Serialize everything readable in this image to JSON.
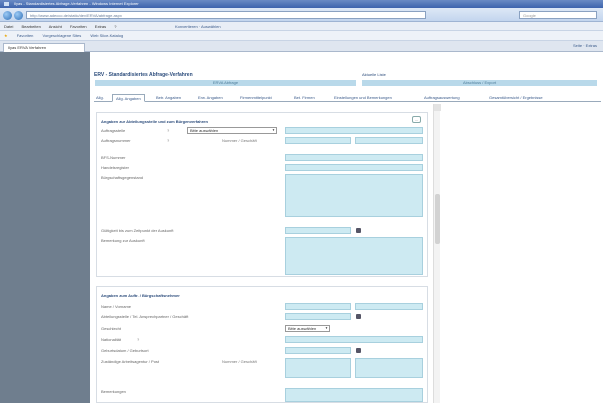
{
  "window": {
    "title": "Ilyas - Standardisiertes Abfrage-Verfahren - Windows Internet Explorer"
  },
  "browser": {
    "url": "http://www.adecco.de/static/dev/ERVA/abfrage.aspx",
    "search_placeholder": "Google",
    "menu": [
      "Datei",
      "Bearbeiten",
      "Ansicht",
      "Favoriten",
      "Extras",
      "?"
    ],
    "menu_right": "Konvertieren · Auswählen",
    "favorites": [
      "Favoriten",
      "Vorgeschlagene Sites",
      "Web Slice-Katalog"
    ],
    "tab_label": "Ilyas ERVA Verfahren",
    "tools": "Seite · Extras"
  },
  "page": {
    "title": "ERV - Standardisiertes Abfrage-Verfahren",
    "subtitle": "Aktuelle Liste",
    "bar_left": "ERVA Abfrage",
    "bar_right": "Abschluss / Export",
    "tabs": [
      "Allg.",
      "Allg. Angaben",
      "Betr. Angaben",
      "Erw. Angaben",
      "Firmenmittelpunkt",
      "Bet. Firmen",
      "Einstellungen und Bemerkungen",
      "Auftragsauswertung",
      "Gesamtübersicht / Ergebnisse"
    ]
  },
  "section1": {
    "heading": "Angaben zur Abteilungsstelle und zum Bürgenverfahren",
    "rows": [
      {
        "label": "Auftragsstelle",
        "select": "Bitte auswählen"
      },
      {
        "label": "Auftragsnummer",
        "sublabel": "Nummer / Geschäft"
      },
      {
        "label": "BFS-Nummer"
      },
      {
        "label": "Handelsregister"
      },
      {
        "label": "Bürgschaftsgegenstand"
      },
      {
        "label": "Gültigkeit bis zum Zeitpunkt der Auskunft"
      },
      {
        "label": "Bemerkung zur Auskunft"
      }
    ]
  },
  "section2": {
    "heading": "Angaben zum Auftr. / Bürgschaftsnehmer",
    "rows": [
      {
        "label": "Name / Vorname"
      },
      {
        "label": "Abteilungsstelle / Tel. Ansprechpartner / Geschäft"
      },
      {
        "label": "Geschlecht",
        "select": "Bitte auswählen"
      },
      {
        "label": "Nationalität"
      },
      {
        "label": "Geburtsdatum / Geburtsort"
      },
      {
        "label": "Zuständige Arbeitsagentur / Post",
        "sublabel": "Nummer / Geschäft"
      },
      {
        "label": "Bemerkungen"
      }
    ]
  }
}
